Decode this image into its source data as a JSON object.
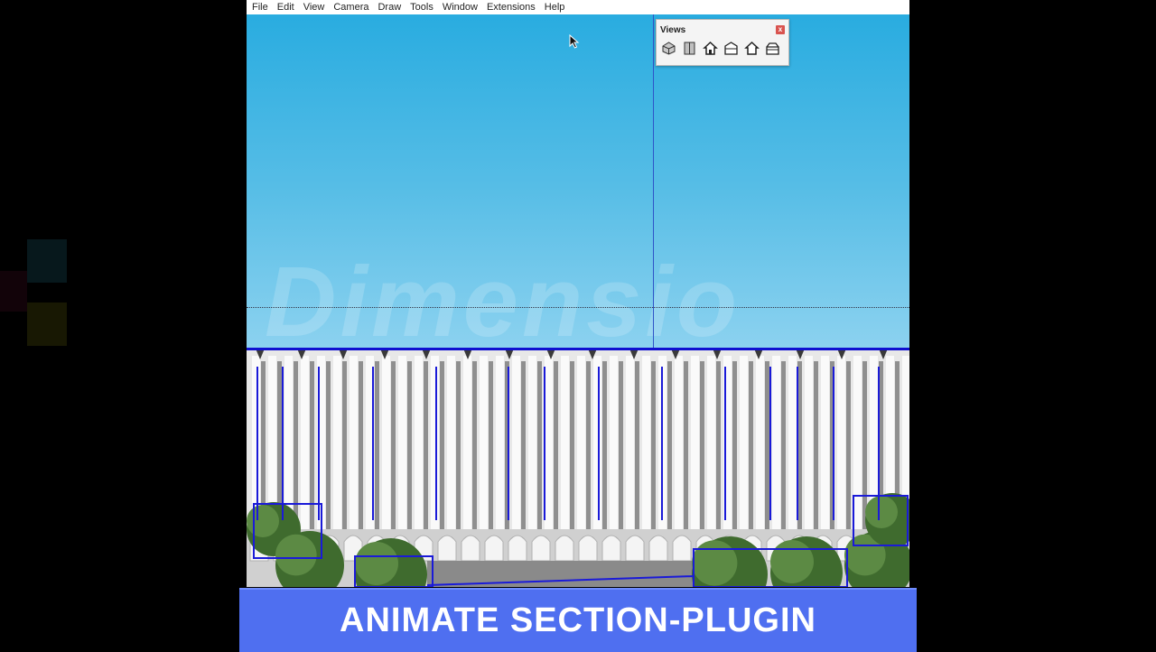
{
  "menu": {
    "items": [
      "File",
      "Edit",
      "View",
      "Camera",
      "Draw",
      "Tools",
      "Window",
      "Extensions",
      "Help"
    ]
  },
  "views_panel": {
    "title": "Views",
    "close_label": "x",
    "icons": [
      "iso-view-icon",
      "top-view-icon",
      "front-view-icon",
      "right-view-icon",
      "back-view-icon",
      "left-view-icon"
    ]
  },
  "watermark": {
    "text": "Dimensio"
  },
  "caption": {
    "text": "ANIMATE SECTION-PLUGIN"
  },
  "colors": {
    "caption_bg": "#4f6ff0",
    "section_line": "#1010d0",
    "sky_top": "#29ace0",
    "sky_bottom": "#b7e3f6"
  }
}
